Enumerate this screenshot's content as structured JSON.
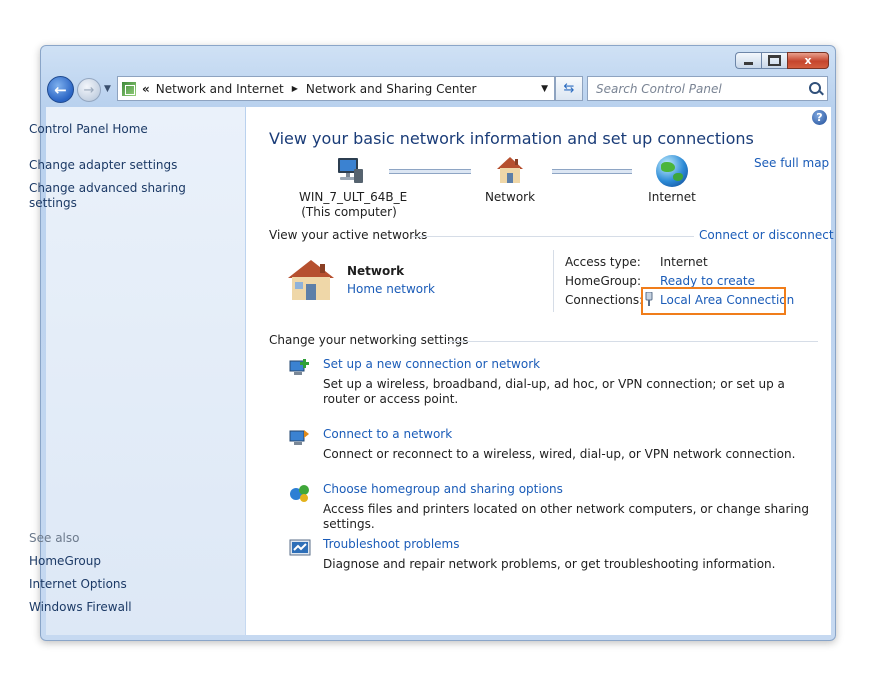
{
  "nav": {
    "back_glyph": "←",
    "forward_glyph": "→",
    "back_icon": "back-arrow-icon",
    "forward_icon": "forward-arrow-icon"
  },
  "address": {
    "chevron": "«",
    "crumbs": [
      "Network and Internet",
      "Network and Sharing Center"
    ],
    "separator": "▶",
    "dropdown": "▼"
  },
  "search": {
    "placeholder": "Search Control Panel"
  },
  "help": {
    "label": "?"
  },
  "caption": {
    "close": "x"
  },
  "sidebar": {
    "links": [
      "Control Panel Home",
      "Change adapter settings",
      "Change advanced sharing settings"
    ],
    "see_also_label": "See also",
    "see_also": [
      "HomeGroup",
      "Internet Options",
      "Windows Firewall"
    ]
  },
  "main": {
    "title": "View your basic network information and set up connections",
    "see_full_map": "See full map",
    "map": {
      "computer_name": "WIN_7_ULT_64B_E",
      "computer_sub": "(This computer)",
      "network": "Network",
      "internet": "Internet"
    },
    "active_networks": {
      "header": "View your active networks",
      "connect_link": "Connect or disconnect",
      "network_name": "Network",
      "network_type": "Home network",
      "access_type_label": "Access type:",
      "access_type_value": "Internet",
      "homegroup_label": "HomeGroup:",
      "homegroup_value": "Ready to create",
      "connections_label": "Connections:",
      "connections_value": "Local Area Connection"
    },
    "settings": {
      "header": "Change your networking settings",
      "tasks": [
        {
          "title": "Set up a new connection or network",
          "desc": "Set up a wireless, broadband, dial-up, ad hoc, or VPN connection; or set up a router or access point."
        },
        {
          "title": "Connect to a network",
          "desc": "Connect or reconnect to a wireless, wired, dial-up, or VPN network connection."
        },
        {
          "title": "Choose homegroup and sharing options",
          "desc": "Access files and printers located on other network computers, or change sharing settings."
        },
        {
          "title": "Troubleshoot problems",
          "desc": "Diagnose and repair network problems, or get troubleshooting information."
        }
      ]
    }
  },
  "colors": {
    "highlight": "#f07d1a",
    "link": "#1b5cb8",
    "title": "#1a3c78"
  }
}
